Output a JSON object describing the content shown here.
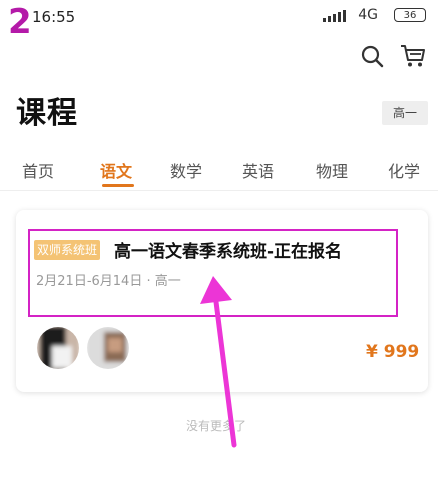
{
  "annotation": {
    "step_number": "2"
  },
  "status_bar": {
    "time": "16:55",
    "network": "4G",
    "battery": "36"
  },
  "header": {
    "title": "课程",
    "grade_selector": "高一"
  },
  "tabs": [
    {
      "label": "首页",
      "active": false
    },
    {
      "label": "语文",
      "active": true
    },
    {
      "label": "数学",
      "active": false
    },
    {
      "label": "英语",
      "active": false
    },
    {
      "label": "物理",
      "active": false
    },
    {
      "label": "化学",
      "active": false
    }
  ],
  "course": {
    "tag": "双师系统班",
    "title": "高一语文春季系统班-正在报名",
    "meta": "2月21日-6月14日 · 高一",
    "price": "¥ 999"
  },
  "footer": {
    "no_more": "没有更多了"
  },
  "colors": {
    "accent": "#e1761c",
    "annotation": "#d423c5",
    "tag_bg": "#f4c374"
  }
}
